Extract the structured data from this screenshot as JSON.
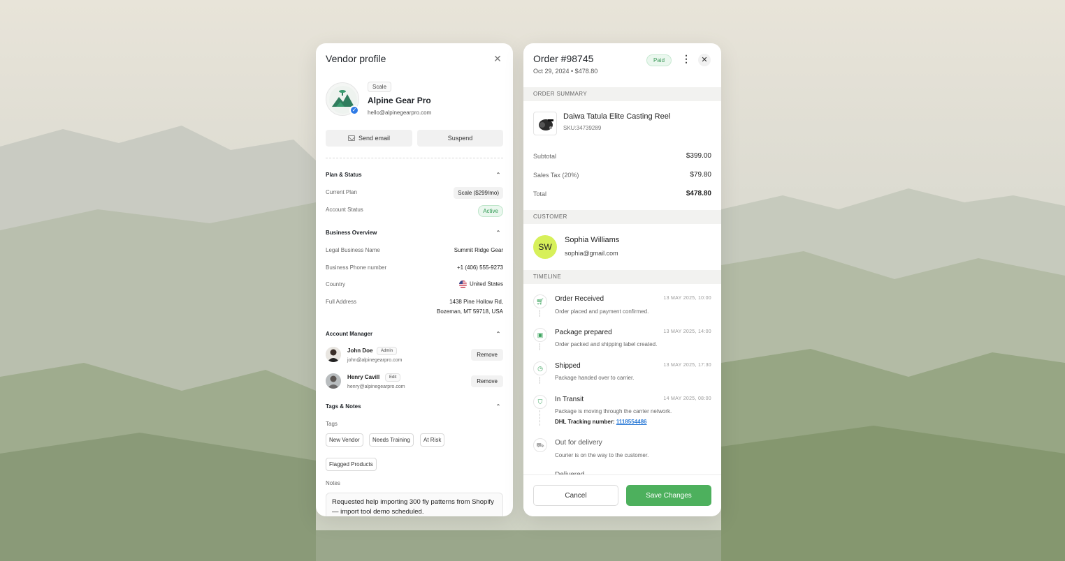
{
  "vendor": {
    "title": "Vendor profile",
    "plan_chip": "Scale",
    "name": "Alpine Gear Pro",
    "email": "hello@alpinegearpro.com",
    "send_email_label": "Send email",
    "suspend_label": "Suspend",
    "plan_status": {
      "heading": "Plan & Status",
      "current_plan_label": "Current Plan",
      "current_plan_value": "Scale ($299/mo)",
      "account_status_label": "Account Status",
      "account_status_value": "Active"
    },
    "business": {
      "heading": "Business Overview",
      "legal_name_label": "Legal Business Name",
      "legal_name_value": "Summit Ridge Gear",
      "phone_label": "Business Phone number",
      "phone_value": "+1 (406) 555-9273",
      "country_label": "Country",
      "country_value": "United States",
      "address_label": "Full Address",
      "address_line1": "1438 Pine Hollow Rd,",
      "address_line2": "Bozeman, MT 59718, USA"
    },
    "managers": {
      "heading": "Account Manager",
      "items": [
        {
          "name": "John Doe",
          "role": "Admin",
          "email": "john@alpinegearpro.com",
          "action": "Remove"
        },
        {
          "name": "Henry Cavill",
          "role": "Edit",
          "email": "henry@alpinegearpro.com",
          "action": "Remove"
        }
      ]
    },
    "tags_notes": {
      "heading": "Tags & Notes",
      "tags_label": "Tags",
      "tags": [
        "New Vendor",
        "Needs Training",
        "At Risk",
        "Flagged Products"
      ],
      "notes_label": "Notes",
      "notes_text": "Requested help importing 300 fly patterns from Shopify — import tool demo scheduled."
    }
  },
  "order": {
    "title": "Order #98745",
    "subtitle": "Oct 29, 2024 • $478.80",
    "status_badge": "Paid",
    "summary_heading": "ORDER SUMMARY",
    "product_name": "Daiwa Tatula Elite Casting Reel",
    "product_sku": "SKU:34739289",
    "subtotal_label": "Subtotal",
    "subtotal_value": "$399.00",
    "tax_label": "Sales Tax (20%)",
    "tax_value": "$79.80",
    "total_label": "Total",
    "total_value": "$478.80",
    "customer_heading": "CUSTOMER",
    "customer_initials": "SW",
    "customer_name": "Sophia Williams",
    "customer_email": "sophia@gmail.com",
    "timeline_heading": "TIMELINE",
    "timeline": [
      {
        "title": "Order Received",
        "desc": "Order placed and payment confirmed.",
        "time": "13 MAY 2025, 10:00",
        "icon": "cart-icon"
      },
      {
        "title": "Package prepared",
        "desc": "Order packed and shipping label created.",
        "time": "13 MAY 2025, 14:00",
        "icon": "box-icon"
      },
      {
        "title": "Shipped",
        "desc": "Package handed over to carrier.",
        "time": "13 MAY 2025, 17:30",
        "icon": "clock-icon"
      },
      {
        "title": "In Transit",
        "desc": "Package is moving through the carrier network.",
        "time": "14 MAY 2025, 08:00",
        "icon": "shield-icon"
      },
      {
        "title": "Out for delivery",
        "desc": "Courier is on the way to the customer.",
        "time": "",
        "icon": "truck-icon"
      },
      {
        "title": "Delivered",
        "desc": "",
        "time": "",
        "icon": "check-icon"
      }
    ],
    "tracking_label": "DHL Tracking number:",
    "tracking_number": "1118554486",
    "cancel_label": "Cancel",
    "save_label": "Save Changes"
  },
  "colors": {
    "accent_green": "#4db05d",
    "paid_green": "#3c9a5a",
    "customer_avatar": "#d7f05a",
    "link_blue": "#2878d6"
  }
}
